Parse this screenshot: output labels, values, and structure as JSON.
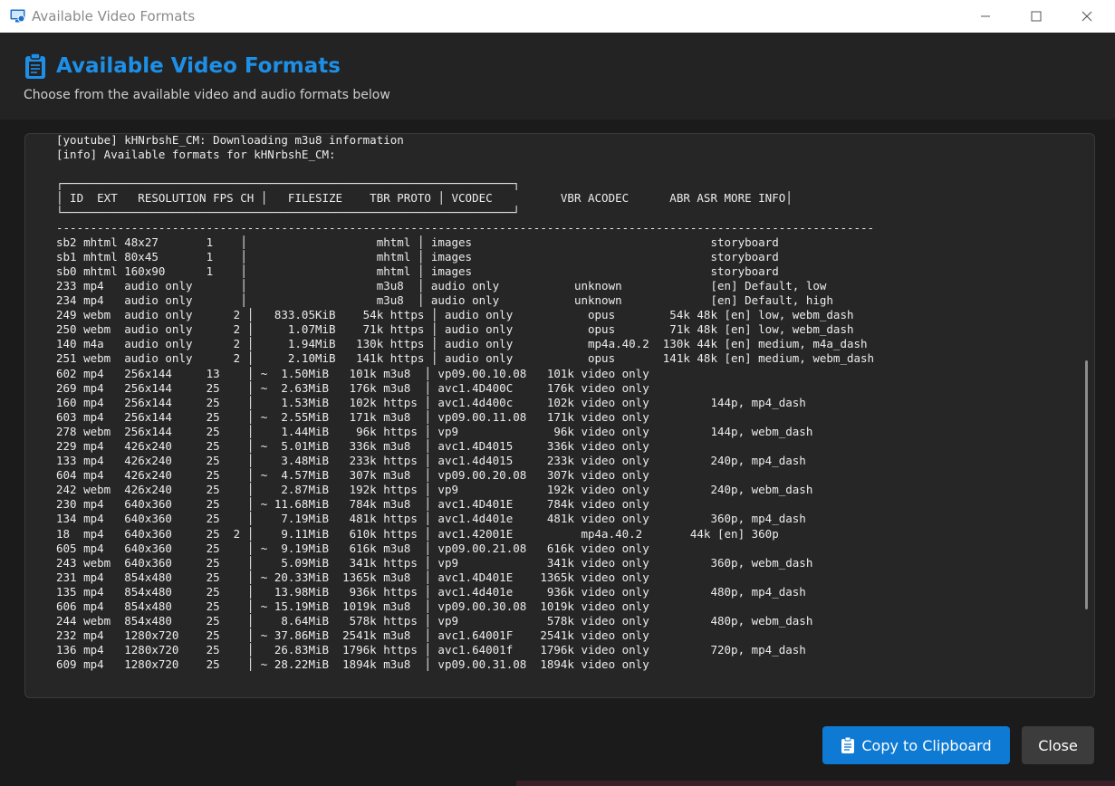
{
  "window": {
    "title": "Available Video Formats",
    "min_glyph": "—",
    "max_glyph": "☐",
    "close_glyph": "✕"
  },
  "header": {
    "title": "Available Video Formats",
    "subtitle": "Choose from the available video and audio formats below",
    "icon": "clipboard-icon",
    "accent_color": "#1e8fe6"
  },
  "output": {
    "lines": [
      "[youtube] kHNrbshE_CM: Downloading m3u8 information",
      "[info] Available formats for kHNrbshE_CM:",
      "",
      "┌──────────────────────────────────────────────────────────────────┐",
      "│ ID  EXT   RESOLUTION FPS CH │   FILESIZE    TBR PROTO │ VCODEC          VBR ACODEC      ABR ASR MORE INFO│",
      "└──────────────────────────────────────────────────────────────────┘",
      "------------------------------------------------------------------------------------------------------------------------",
      "sb2 mhtml 48x27       1    │                   mhtml │ images                                   storyboard",
      "sb1 mhtml 80x45       1    │                   mhtml │ images                                   storyboard",
      "sb0 mhtml 160x90      1    │                   mhtml │ images                                   storyboard",
      "233 mp4   audio only       │                   m3u8  │ audio only           unknown             [en] Default, low",
      "234 mp4   audio only       │                   m3u8  │ audio only           unknown             [en] Default, high",
      "249 webm  audio only      2 │   833.05KiB    54k https │ audio only           opus        54k 48k [en] low, webm_dash",
      "250 webm  audio only      2 │     1.07MiB    71k https │ audio only           opus        71k 48k [en] low, webm_dash",
      "140 m4a   audio only      2 │     1.94MiB   130k https │ audio only           mp4a.40.2  130k 44k [en] medium, m4a_dash",
      "251 webm  audio only      2 │     2.10MiB   141k https │ audio only           opus       141k 48k [en] medium, webm_dash",
      "602 mp4   256x144     13    │ ~  1.50MiB   101k m3u8  │ vp09.00.10.08   101k video only",
      "269 mp4   256x144     25    │ ~  2.63MiB   176k m3u8  │ avc1.4D400C     176k video only",
      "160 mp4   256x144     25    │    1.53MiB   102k https │ avc1.4d400c     102k video only         144p, mp4_dash",
      "603 mp4   256x144     25    │ ~  2.55MiB   171k m3u8  │ vp09.00.11.08   171k video only",
      "278 webm  256x144     25    │    1.44MiB    96k https │ vp9              96k video only         144p, webm_dash",
      "229 mp4   426x240     25    │ ~  5.01MiB   336k m3u8  │ avc1.4D4015     336k video only",
      "133 mp4   426x240     25    │    3.48MiB   233k https │ avc1.4d4015     233k video only         240p, mp4_dash",
      "604 mp4   426x240     25    │ ~  4.57MiB   307k m3u8  │ vp09.00.20.08   307k video only",
      "242 webm  426x240     25    │    2.87MiB   192k https │ vp9             192k video only         240p, webm_dash",
      "230 mp4   640x360     25    │ ~ 11.68MiB   784k m3u8  │ avc1.4D401E     784k video only",
      "134 mp4   640x360     25    │    7.19MiB   481k https │ avc1.4d401e     481k video only         360p, mp4_dash",
      "18  mp4   640x360     25  2 │    9.11MiB   610k https │ avc1.42001E          mp4a.40.2       44k [en] 360p",
      "605 mp4   640x360     25    │ ~  9.19MiB   616k m3u8  │ vp09.00.21.08   616k video only",
      "243 webm  640x360     25    │    5.09MiB   341k https │ vp9             341k video only         360p, webm_dash",
      "231 mp4   854x480     25    │ ~ 20.33MiB  1365k m3u8  │ avc1.4D401E    1365k video only",
      "135 mp4   854x480     25    │   13.98MiB   936k https │ avc1.4d401e     936k video only         480p, mp4_dash",
      "606 mp4   854x480     25    │ ~ 15.19MiB  1019k m3u8  │ vp09.00.30.08  1019k video only",
      "244 webm  854x480     25    │    8.64MiB   578k https │ vp9             578k video only         480p, webm_dash",
      "232 mp4   1280x720    25    │ ~ 37.86MiB  2541k m3u8  │ avc1.64001F    2541k video only",
      "136 mp4   1280x720    25    │   26.83MiB  1796k https │ avc1.64001f    1796k video only         720p, mp4_dash",
      "609 mp4   1280x720    25    │ ~ 28.22MiB  1894k m3u8  │ vp09.00.31.08  1894k video only"
    ]
  },
  "buttons": {
    "copy_label": "Copy to Clipboard",
    "close_label": "Close",
    "copy_color": "#0e7ad3"
  }
}
